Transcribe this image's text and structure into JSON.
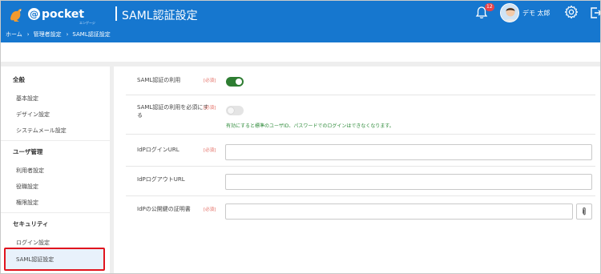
{
  "header": {
    "logo_text": "pocket",
    "logo_sub": "エンゲージ",
    "title": "SAML認証設定",
    "notification_count": "12",
    "user_name": "デモ 太郎",
    "colors": {
      "header_bg": "#1677cf",
      "accent_green": "#2e7d32",
      "required_red": "#e36b62",
      "highlight_red": "#e0141e"
    }
  },
  "breadcrumb": [
    {
      "label": "ホーム"
    },
    {
      "label": "管理者設定"
    },
    {
      "label": "SAML認証設定"
    }
  ],
  "sidebar": {
    "sections": [
      {
        "heading": "全般",
        "items": [
          "基本設定",
          "デザイン設定",
          "システムメール設定"
        ]
      },
      {
        "heading": "ユーザ管理",
        "items": [
          "利用者設定",
          "役職設定",
          "権限設定"
        ]
      },
      {
        "heading": "セキュリティ",
        "items": [
          "ログイン設定",
          "SAML認証設定"
        ]
      }
    ],
    "active_item": "SAML認証設定"
  },
  "form": {
    "required_label": "[必須]",
    "fields": {
      "use_saml": {
        "label": "SAML認証の利用",
        "required": true,
        "value": "on"
      },
      "require_saml": {
        "label_line1": "SAML認証の利用を必須にす",
        "label_line2": "る",
        "required": true,
        "value": "off",
        "hint": "有効にすると標準のユーザID、パスワードでのログインはできなくなります。"
      },
      "idp_login_url": {
        "label": "IdPログインURL",
        "required": true,
        "value": "",
        "placeholder": ""
      },
      "idp_logout_url": {
        "label": "IdPログアウトURL",
        "required": false,
        "value": "",
        "placeholder": ""
      },
      "idp_certificate": {
        "label": "IdPの公開鍵の証明書",
        "required": true,
        "value": "",
        "placeholder": ""
      }
    }
  },
  "icons": [
    "kangaroo-logo-icon",
    "bell-icon",
    "avatar",
    "gear-icon",
    "logout-icon",
    "paperclip-icon"
  ]
}
